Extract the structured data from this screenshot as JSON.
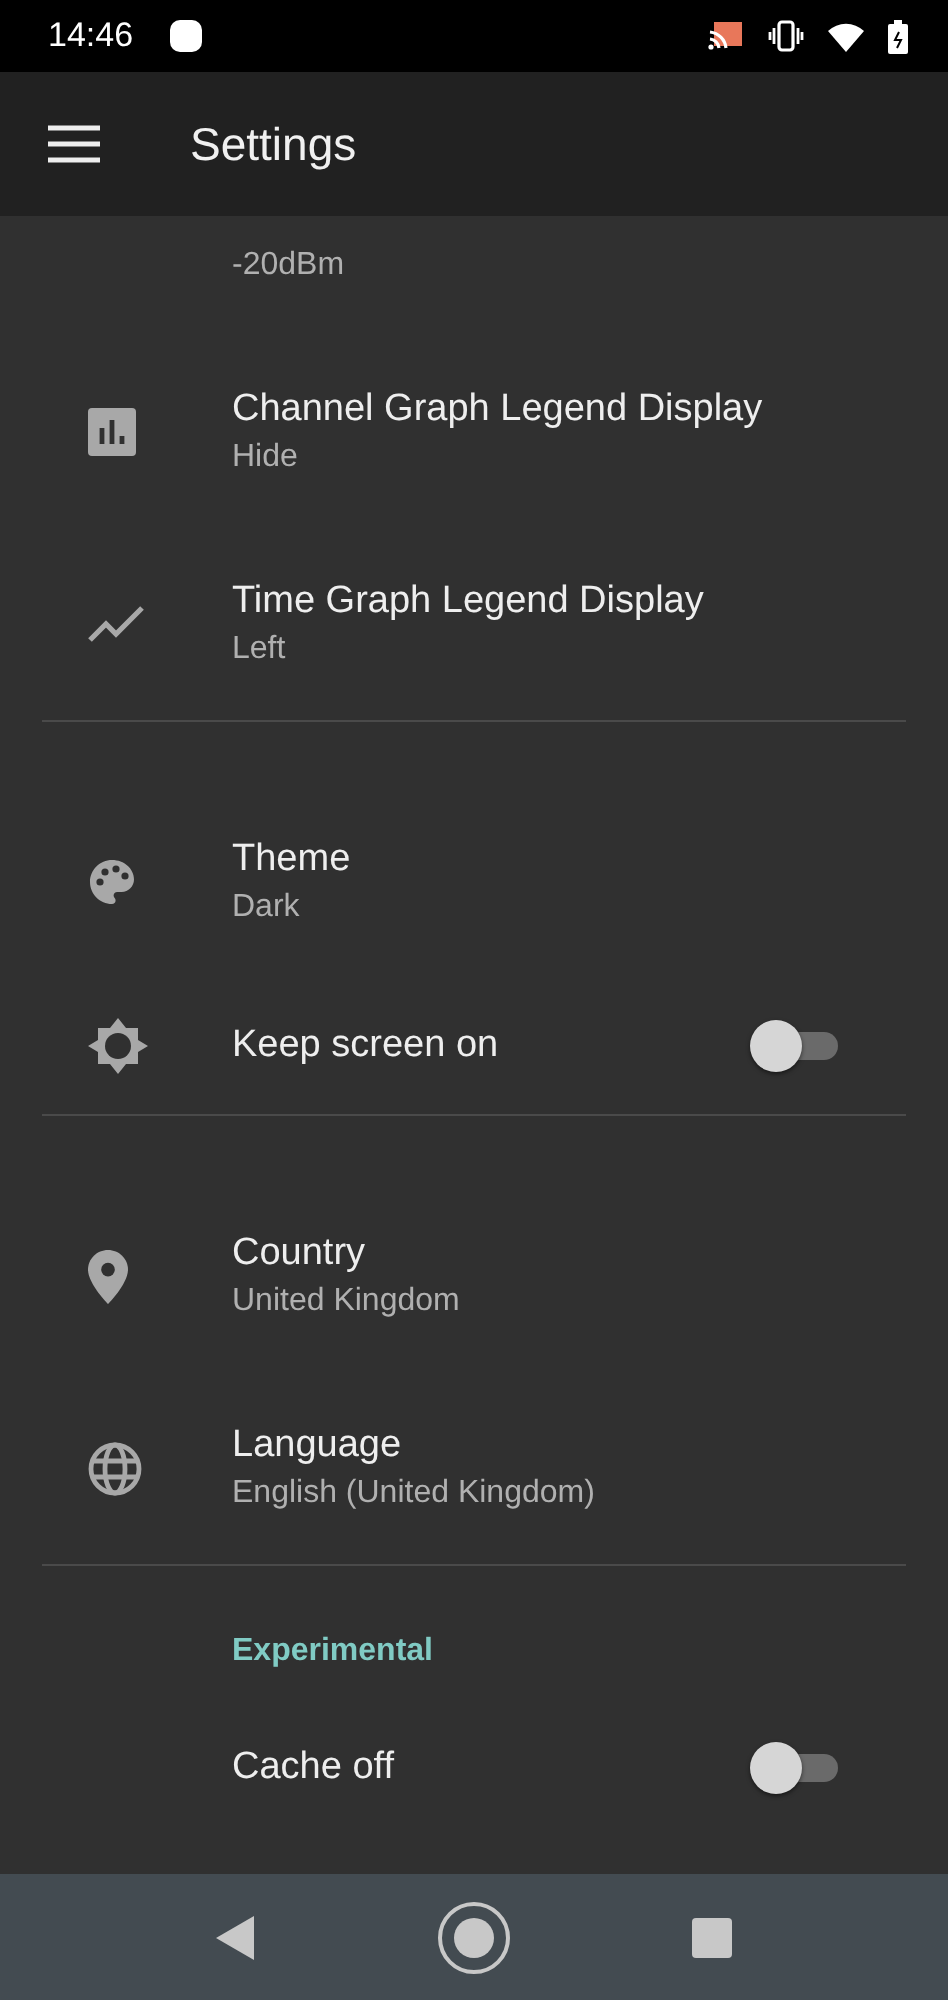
{
  "status_bar": {
    "time": "14:46"
  },
  "app_bar": {
    "title": "Settings"
  },
  "sections": [
    {
      "items": [
        {
          "kind": "cut",
          "summary": "-20dBm"
        },
        {
          "kind": "pref",
          "title": "Channel Graph Legend Display",
          "summary": "Hide"
        },
        {
          "kind": "pref",
          "title": "Time Graph Legend Display",
          "summary": "Left"
        }
      ]
    },
    {
      "items": [
        {
          "kind": "pref",
          "title": "Theme",
          "summary": "Dark"
        },
        {
          "kind": "switch",
          "title": "Keep screen on",
          "on": false
        }
      ]
    },
    {
      "items": [
        {
          "kind": "pref",
          "title": "Country",
          "summary": "United Kingdom"
        },
        {
          "kind": "pref",
          "title": "Language",
          "summary": "English (United Kingdom)"
        }
      ]
    },
    {
      "items": [
        {
          "kind": "header",
          "title": "Experimental"
        },
        {
          "kind": "switch",
          "title": "Cache off",
          "on": false
        }
      ]
    }
  ]
}
